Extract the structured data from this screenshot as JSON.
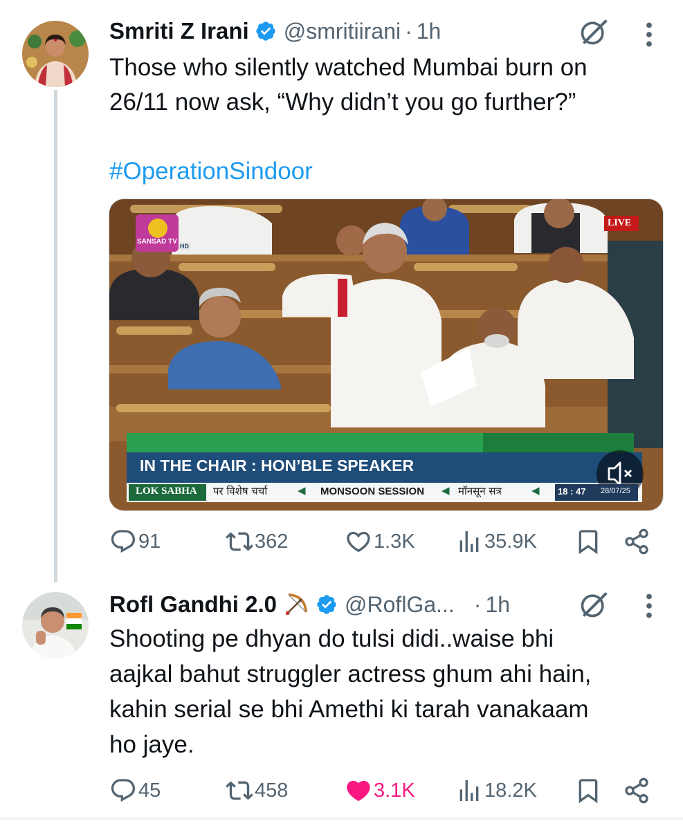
{
  "tweet1": {
    "name": "Smriti Z Irani",
    "handle": "@smritiirani",
    "dot": "·",
    "time": "1h",
    "line1": "Those who silently watched Mumbai burn on",
    "line2": "26/11 now ask, “Why didn’t you go further?”",
    "hashtag": "#OperationSindoor",
    "video": {
      "channel_logo": "SANSAD TV",
      "hd": "HD",
      "live": "LIVE",
      "banner": "IN THE CHAIR : HON’BLE SPEAKER",
      "ticker_label": "LOK SABHA",
      "ticker_1": "पर विशेष चर्चा",
      "ticker_2": "MONSOON SESSION",
      "ticker_3": "मॉनसून सत्र",
      "clock": "18 : 47",
      "date": "28/07/25"
    },
    "stats": {
      "replies": "91",
      "reposts": "362",
      "likes": "1.3K",
      "views": "35.9K"
    }
  },
  "tweet2": {
    "name": "Rofl Gandhi 2.0",
    "handle": "@RoflGa...",
    "dot": "·",
    "time": "1h",
    "line1": "Shooting pe dhyan do tulsi didi..waise bhi",
    "line2": "aajkal bahut struggler actress ghum ahi hain,",
    "line3": "kahin serial se bhi Amethi ki tarah vanakaam",
    "line4": "ho jaye.",
    "stats": {
      "replies": "45",
      "reposts": "458",
      "likes": "3.1K",
      "views": "18.2K"
    }
  },
  "colors": {
    "accent": "#1d9bf0",
    "muted": "#536471",
    "like": "#f91880",
    "text": "#0f1419"
  },
  "icons": [
    "reply-icon",
    "repost-icon",
    "like-icon",
    "views-icon",
    "bookmark-icon",
    "share-icon",
    "grok-icon",
    "more-icon",
    "verified-badge-icon",
    "bow-arrow-emoji"
  ]
}
